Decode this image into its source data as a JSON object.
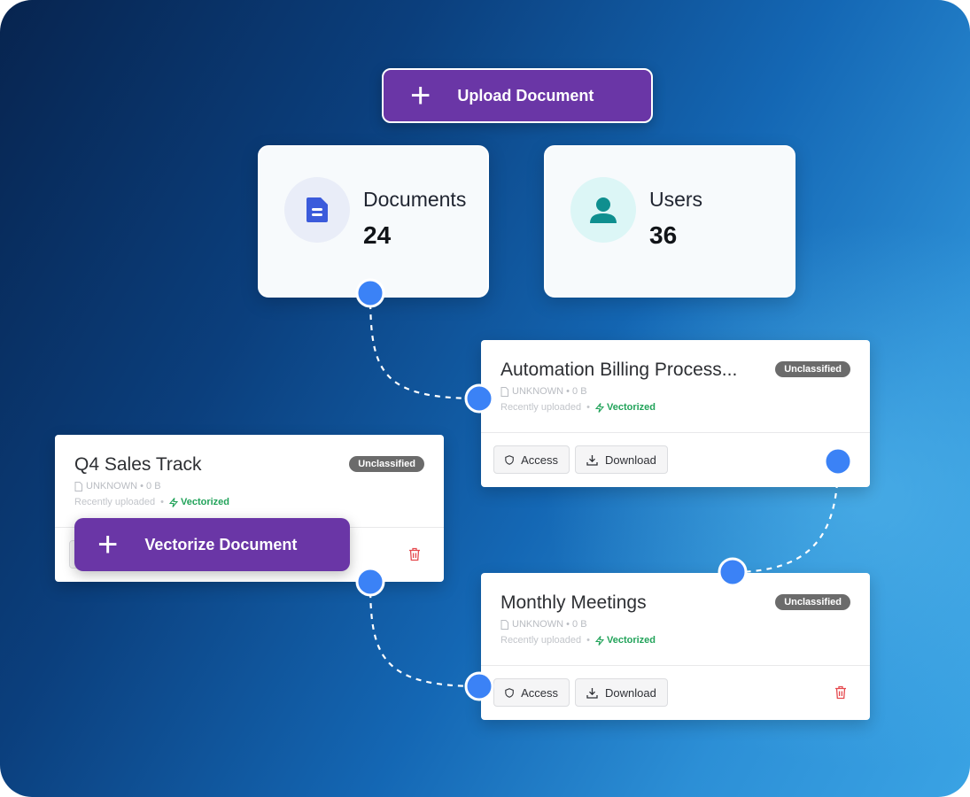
{
  "actions": {
    "upload_label": "Upload Document",
    "vectorize_label": "Vectorize Document"
  },
  "stats": {
    "documents": {
      "label": "Documents",
      "value": "24",
      "icon": "document-icon"
    },
    "users": {
      "label": "Users",
      "value": "36",
      "icon": "user-icon"
    }
  },
  "documents": [
    {
      "title": "Automation Billing Process...",
      "badge": "Unclassified",
      "meta": "UNKNOWN • 0 B",
      "uploaded": "Recently uploaded",
      "status": "Vectorized",
      "access_label": "Access",
      "download_label": "Download"
    },
    {
      "title": "Q4 Sales Track",
      "badge": "Unclassified",
      "meta": "UNKNOWN • 0 B",
      "uploaded": "Recently uploaded",
      "status": "Vectorized"
    },
    {
      "title": "Monthly Meetings",
      "badge": "Unclassified",
      "meta": "UNKNOWN • 0 B",
      "uploaded": "Recently uploaded",
      "status": "Vectorized",
      "access_label": "Access",
      "download_label": "Download"
    }
  ],
  "colors": {
    "accent_purple": "#6a36a6",
    "connector_dot": "#3b82f6",
    "vectorized_green": "#22a35a",
    "delete_red": "#e5484d",
    "documents_icon": "#3b5bdb",
    "users_icon": "#0f8f8f"
  }
}
